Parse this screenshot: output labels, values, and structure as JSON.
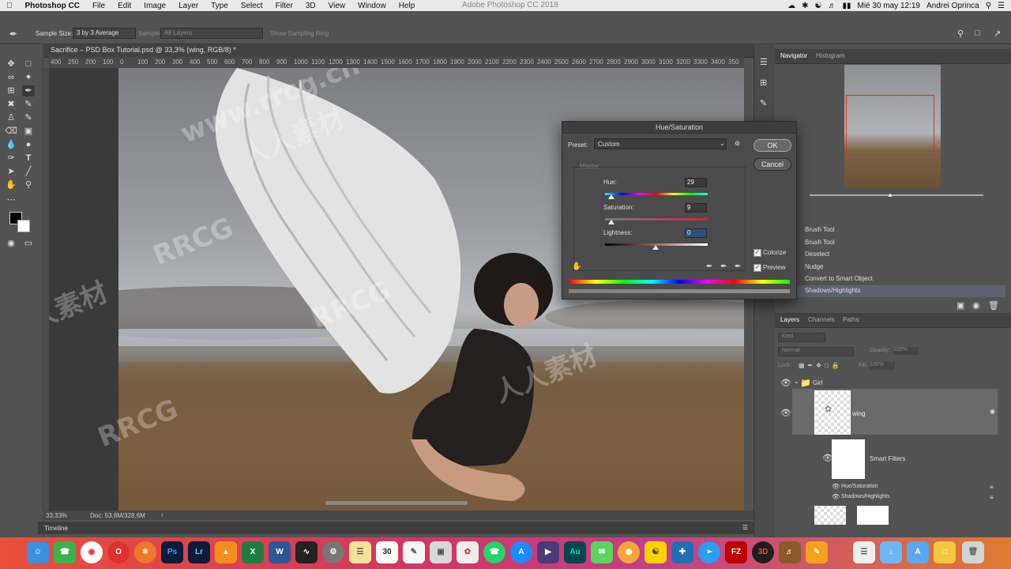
{
  "menubar": {
    "app_name": "Photoshop CC",
    "items": [
      "File",
      "Edit",
      "Image",
      "Layer",
      "Type",
      "Select",
      "Filter",
      "3D",
      "View",
      "Window",
      "Help"
    ],
    "center_title": "Adobe Photoshop CC 2018",
    "clock": "Mié 30 may  12:19",
    "user": "Andrei Oprinca"
  },
  "options_bar": {
    "sample_size_label": "Sample Size:",
    "sample_size_value": "3 by 3 Average",
    "sample_label": "Sample:",
    "sample_value": "All Layers",
    "show_ring": "Show Sampling Ring"
  },
  "document": {
    "tab_title": "Sacrifice – PSD Box Tutorial.psd @ 33,3% (wing, RGB/8) *",
    "ruler_ticks": [
      "400",
      "250",
      "200",
      "100",
      "0",
      "100",
      "200",
      "300",
      "400",
      "500",
      "600",
      "700",
      "800",
      "900",
      "1000",
      "1100",
      "1200",
      "1300",
      "1400",
      "1500",
      "1600",
      "1700",
      "1800",
      "1900",
      "2000",
      "2100",
      "2200",
      "2300",
      "2400",
      "2500",
      "2600",
      "2700",
      "2800",
      "2900",
      "3000",
      "3100",
      "3200",
      "3300",
      "3400",
      "350"
    ],
    "zoom": "33,33%",
    "doc_size": "Doc: 53,8M/328,6M",
    "timeline_label": "Timeline"
  },
  "navigator": {
    "tabs": [
      "Navigator",
      "Histogram"
    ]
  },
  "history": {
    "items": [
      "Brush Tool",
      "Brush Tool",
      "Deselect",
      "Nudge",
      "Convert to Smart Object",
      "Shadows/Highlights"
    ]
  },
  "layers": {
    "tabs": [
      "Layers",
      "Channels",
      "Paths"
    ],
    "kind_placeholder": "Kind",
    "blend_mode": "Normal",
    "opacity_label": "Opacity:",
    "opacity_value": "100%",
    "lock_label": "Lock:",
    "fill_label": "Fill:",
    "fill_value": "100%",
    "group_name": "Girl",
    "layer_name": "wing",
    "smart_filters_label": "Smart Filters",
    "filters": [
      "Hue/Saturation",
      "Shadows/Highlights"
    ]
  },
  "dialog": {
    "title": "Hue/Saturation",
    "preset_label": "Preset:",
    "preset_value": "Custom",
    "channel": "Master",
    "hue_label": "Hue:",
    "hue_value": "29",
    "saturation_label": "Saturation:",
    "saturation_value": "9",
    "lightness_label": "Lightness:",
    "lightness_value": "0",
    "ok_label": "OK",
    "cancel_label": "Cancel",
    "colorize_label": "Colorize",
    "colorize_checked": true,
    "preview_label": "Preview",
    "preview_checked": true
  },
  "dock": {
    "badge_calendar": "30",
    "apps": [
      "Finder",
      "FaceTime",
      "Chrome",
      "Opera",
      "Firefox",
      "Ps",
      "Lr",
      "VLC",
      "Excel",
      "Word",
      "Activity",
      "Preferences",
      "Notes",
      "Calendar",
      "TextEdit",
      "Preview",
      "Photos",
      "WhatsApp",
      "App Store",
      "Premiere",
      "Au",
      "Messages",
      "Blender",
      "Sublime",
      "Screen",
      "Safari",
      "FileZilla",
      "3DS",
      "Garage",
      "Pages",
      "Reminders",
      "Downloads",
      "Folder",
      "Trash"
    ]
  },
  "watermark": {
    "text_latin": "RRCG",
    "text_cjk": "人人素材",
    "url": "www.rrcg.cn"
  }
}
